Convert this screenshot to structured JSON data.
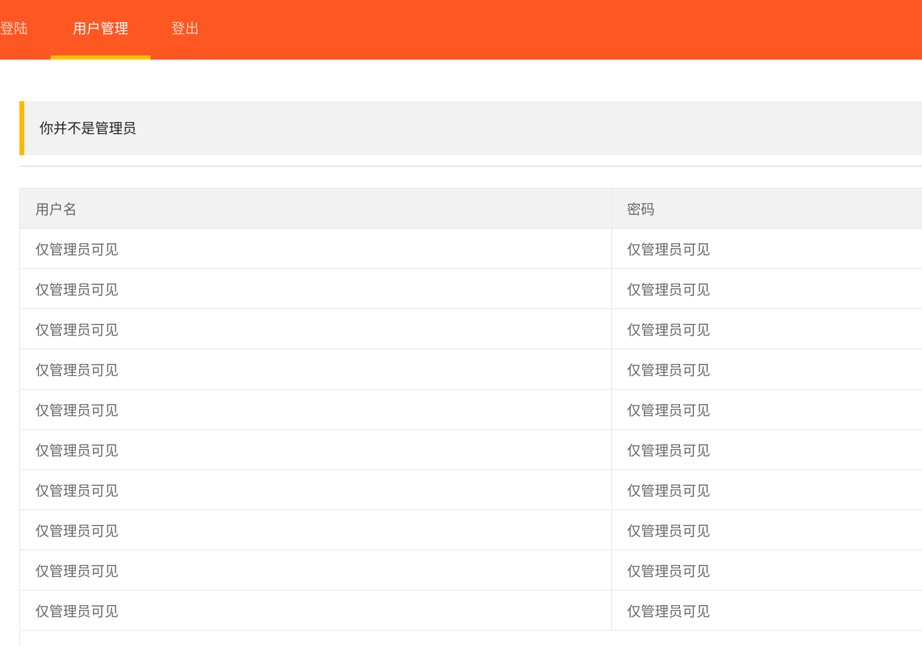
{
  "nav": {
    "items": [
      {
        "label": "登陆",
        "active": false
      },
      {
        "label": "用户管理",
        "active": true
      },
      {
        "label": "登出",
        "active": false
      }
    ]
  },
  "notice": {
    "text": "你并不是管理员"
  },
  "table": {
    "columns": [
      "用户名",
      "密码"
    ],
    "rows": [
      [
        "仅管理员可见",
        "仅管理员可见"
      ],
      [
        "仅管理员可见",
        "仅管理员可见"
      ],
      [
        "仅管理员可见",
        "仅管理员可见"
      ],
      [
        "仅管理员可见",
        "仅管理员可见"
      ],
      [
        "仅管理员可见",
        "仅管理员可见"
      ],
      [
        "仅管理员可见",
        "仅管理员可见"
      ],
      [
        "仅管理员可见",
        "仅管理员可见"
      ],
      [
        "仅管理员可见",
        "仅管理员可见"
      ],
      [
        "仅管理员可见",
        "仅管理员可见"
      ],
      [
        "仅管理员可见",
        "仅管理员可见"
      ]
    ]
  },
  "colors": {
    "nav_background": "#FF5722",
    "nav_active_underline": "#FFC107",
    "notice_border": "#FFB800",
    "notice_background": "#F2F2F2"
  }
}
